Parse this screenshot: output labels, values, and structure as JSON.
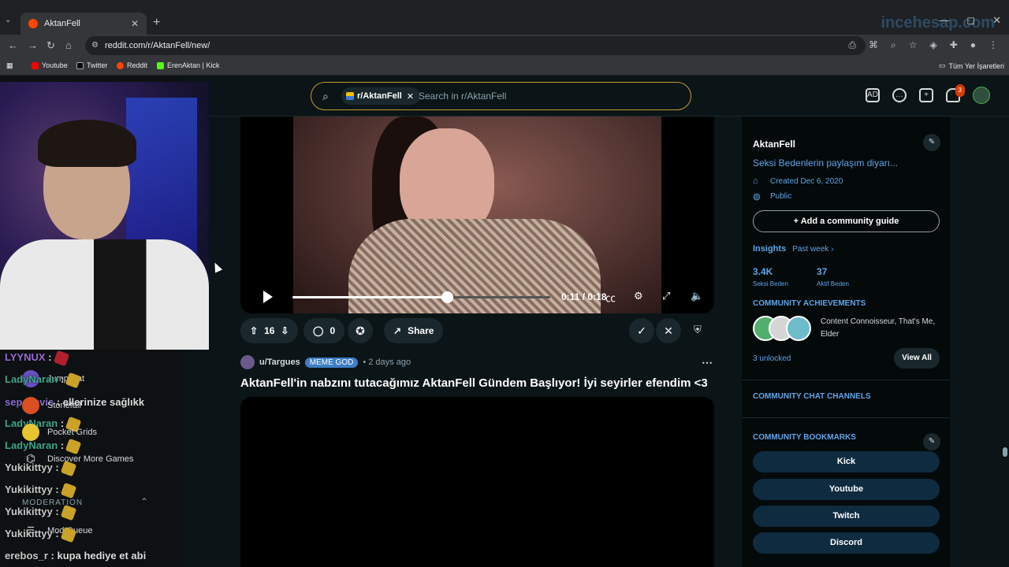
{
  "browser": {
    "tab_title": "AktanFell",
    "url": "reddit.com/r/AktanFell/new/",
    "watermark": "incehesap.com",
    "bookmarks": [
      "Youtube",
      "Twitter",
      "Reddit",
      "ErenAktan | Kick"
    ],
    "all_bookmarks": "Tüm Yer İşaretleri"
  },
  "header": {
    "chip_label": "r/AktanFell",
    "search_placeholder": "Search in r/AktanFell",
    "notification_count": "3"
  },
  "overlay": {
    "chat": [
      {
        "user": "LYYNUX",
        "text": ":"
      },
      {
        "user": "LadyNaran",
        "text": ":"
      },
      {
        "user": "sepakevic",
        "text": ": ellerinize sağlıkk"
      },
      {
        "user": "LadyNaran",
        "text": ":"
      },
      {
        "user": "LadyNaran",
        "text": ":"
      },
      {
        "user": "Yukikittyy",
        "text": ":"
      },
      {
        "user": "Yukikittyy",
        "text": ":"
      },
      {
        "user": "Yukikittyy",
        "text": ":"
      },
      {
        "user": "Yukikittyy",
        "text": ":"
      },
      {
        "user": "erebos_r",
        "text": ": kupa hediye et abi"
      }
    ],
    "games": [
      "Jump Cat",
      "Stonefall",
      "Pocket Grids",
      "Discover More Games"
    ],
    "moderation_label": "MODERATION",
    "mod_queue": "Mod Queue"
  },
  "post1": {
    "time_current": "0:11",
    "time_total": "0:18",
    "progress": 0.6,
    "votes": "16",
    "comments": "0",
    "share_label": "Share"
  },
  "post2": {
    "user": "u/Targues",
    "flair": "MEME GOD",
    "time": "2 days ago",
    "title": "AktanFell'in nabzını tutacağımız AktanFell Gündem Başlıyor! İyi seyirler efendim <3"
  },
  "sidebar": {
    "name": "AktanFell",
    "description": "Seksi Bedenlerin paylaşım diyarı...",
    "created": "Created Dec 6, 2020",
    "visibility": "Public",
    "guide_button": "Add a community guide",
    "insights_label": "Insights",
    "insights_period": "Past week",
    "stats": [
      {
        "value": "3.4K",
        "label": "Seksi Beden"
      },
      {
        "value": "37",
        "label": "Aktif Beden"
      }
    ],
    "achievements_heading": "COMMUNITY ACHIEVEMENTS",
    "achievements_text": "Content Connoisseur, That's Me, Elder",
    "unlocked": "3 unlocked",
    "view_all": "View All",
    "chat_heading": "COMMUNITY CHAT CHANNELS",
    "bookmarks_heading": "COMMUNITY BOOKMARKS",
    "bookmark_buttons": [
      "Kick",
      "Youtube",
      "Twitch",
      "Discord"
    ]
  }
}
